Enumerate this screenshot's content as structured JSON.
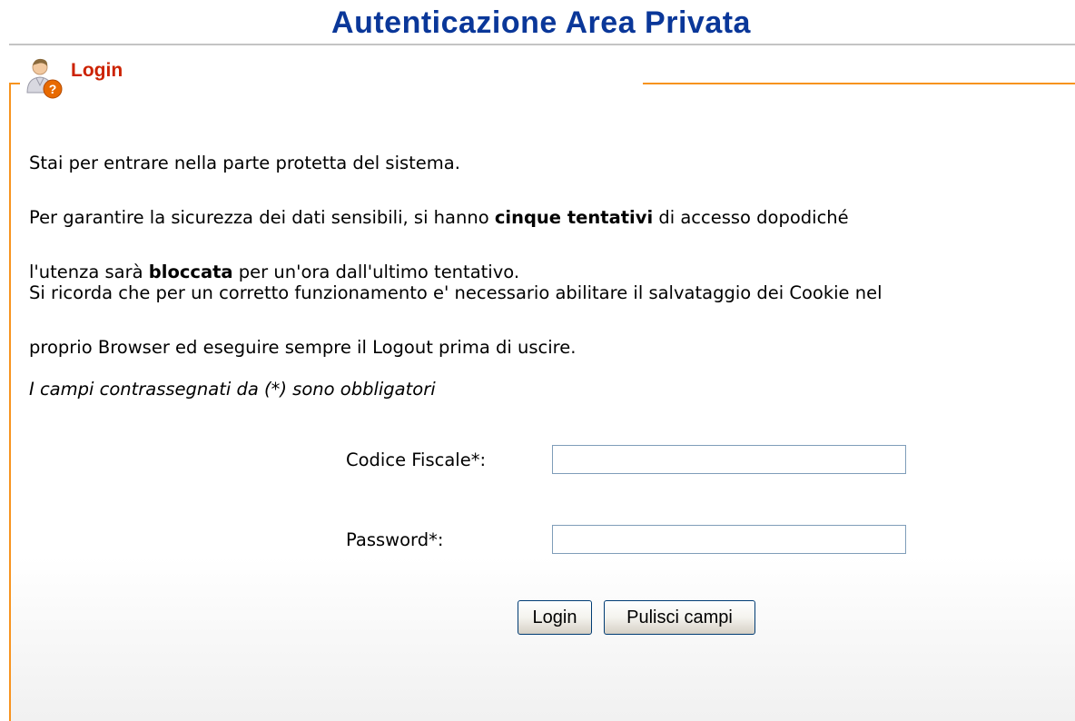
{
  "header": {
    "title": "Autenticazione Area Privata"
  },
  "section": {
    "legend_label": "Login",
    "legend_icon": "user-help-icon"
  },
  "intro": {
    "line1": "Stai per entrare nella parte protetta del sistema.",
    "line2_prefix": "Per garantire la sicurezza dei dati sensibili, si hanno ",
    "line2_bold": "cinque tentativi",
    "line2_suffix": " di accesso dopodiché",
    "line3_prefix": "l'utenza sarà ",
    "line3_bold": "bloccata",
    "line3_suffix": " per un'ora dall'ultimo tentativo."
  },
  "cookie_notice": {
    "line1": "Si ricorda che per un corretto funzionamento e' necessario abilitare il salvataggio dei Cookie nel",
    "line2": "proprio Browser ed eseguire sempre il Logout prima di uscire."
  },
  "required_note": "I campi contrassegnati da (*) sono obbligatori",
  "form": {
    "codice_fiscale_label": "Codice Fiscale*:",
    "codice_fiscale_value": "",
    "password_label": "Password*:",
    "password_value": "",
    "login_button": "Login",
    "clear_button": "Pulisci campi"
  },
  "colors": {
    "title": "#0a3799",
    "accent": "#f7931e",
    "legend_text": "#cc2200"
  }
}
